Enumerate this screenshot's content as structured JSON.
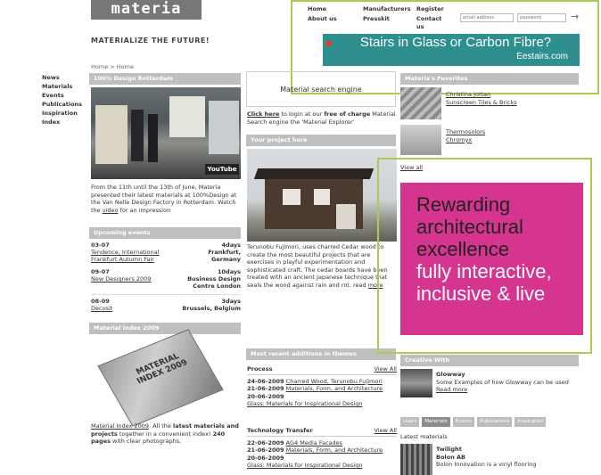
{
  "logo": {
    "text": "materia"
  },
  "tagline": "MATERIALIZE THE FUTURE!",
  "topnav": {
    "col1": [
      "Home",
      "About us"
    ],
    "col2": [
      "Manufacturers",
      "Presskit"
    ],
    "col3": [
      "Register",
      "Contact us"
    ],
    "email_placeholder": "email address",
    "password_placeholder": "password",
    "go": "→"
  },
  "ad_top": {
    "headline": "Stairs in Glass or Carbon Fibre?",
    "site": "Eestairs.com"
  },
  "breadcrumb": "Home > Home",
  "leftnav": [
    "News",
    "Materials",
    "Events",
    "Publications",
    "Inspiration",
    "Index"
  ],
  "news": {
    "header": "100% Design Rotterdam",
    "youtube": "YouTube",
    "text_before": "From the 11th until the 13th of June, Materia presented their latest materials at 100%Design at the Van Nelle Design Factory in Rotterdam. Watch the ",
    "link": "video",
    "text_after": " for an impression"
  },
  "events": {
    "header": "Upcoming events",
    "items": [
      {
        "date": "03-07",
        "days": "4days",
        "title": "Tendence, International Frankfurt Autumn Fair",
        "location": "Frankfurt, Germany"
      },
      {
        "date": "09-07",
        "days": "10days",
        "title": "New Designers 2009",
        "location": "Business Design Centre London"
      },
      {
        "date": "08-09",
        "days": "3days",
        "title": "Decosit",
        "location": "Brussels, Belgium"
      }
    ]
  },
  "index": {
    "header": "Material Index 2009",
    "cover": "MATERIAL INDEX 2009",
    "link": "Material Index 2009",
    "t1": ". All the ",
    "b1": "latest materials and projects",
    "t2": " together in a convenient index! ",
    "b2": "240 pages",
    "t3": " with clear photographs,"
  },
  "search": {
    "title": "Material search engine",
    "link": "Click here",
    "t1": " to login at our ",
    "b1": "free of charge",
    "t2": " Material Search engine the 'Material Explorer'"
  },
  "project": {
    "header": "Your project here",
    "text": "Terunobu Fujimori, uses charred Cedar wood to create the most beautiful projects that are exercises in playful experimentation and sophisticated craft. The cedar boards have been treated with an ancient Japanese technique that seals the wood against rain and rot.  read ",
    "more": "more"
  },
  "recent": {
    "header": "Most recent additions in themes",
    "process": {
      "title": "Process",
      "viewall": "View All",
      "items": [
        {
          "date": "24-06-2009",
          "label": "Charred Wood, Terunobu Fujimori"
        },
        {
          "date": "21-06-2009",
          "label": "Materials, Form, and Architecture"
        },
        {
          "date": "20-06-2009",
          "label": "Glass: Materials for Inspirational Design"
        }
      ]
    },
    "tech": {
      "title": "Technology Transfer",
      "viewall": "View All",
      "items": [
        {
          "date": "22-06-2009",
          "label": "AG4 Media Facades"
        },
        {
          "date": "21-06-2009",
          "label": "Materials, Form, and Architecture"
        },
        {
          "date": "20-06-2009",
          "label": "Glass: Materials for Inspirational Design"
        }
      ]
    }
  },
  "favorites": {
    "header": "Materia's Favorites",
    "items": [
      "Christina Jottan",
      "Sunscreen Tiles & Bricks",
      "Thermosolors",
      "Chromyx"
    ],
    "viewall": "View all"
  },
  "ad_right": {
    "l1": "Rewarding",
    "l2": "architectural",
    "l3": "excellence",
    "l4": "fully interactive,",
    "l5": "inclusive & live"
  },
  "creative": {
    "header": "Creative With",
    "title": "Glowway",
    "text": "Some Examples of how Glowway can be used ",
    "link": "Read more"
  },
  "tabs": [
    "Users",
    "Materials",
    "Events",
    "Publications",
    "Inspiration"
  ],
  "latest": {
    "label": "Latest materials",
    "title": "Twilight",
    "company": "Bolon AB",
    "text": "Bolon Innovation is a vinyl flooring"
  },
  "colors": {
    "pink": "#d6358f",
    "teal": "#2f8f8f",
    "green": "#a8cc55",
    "bar": "#bfbfbf"
  }
}
